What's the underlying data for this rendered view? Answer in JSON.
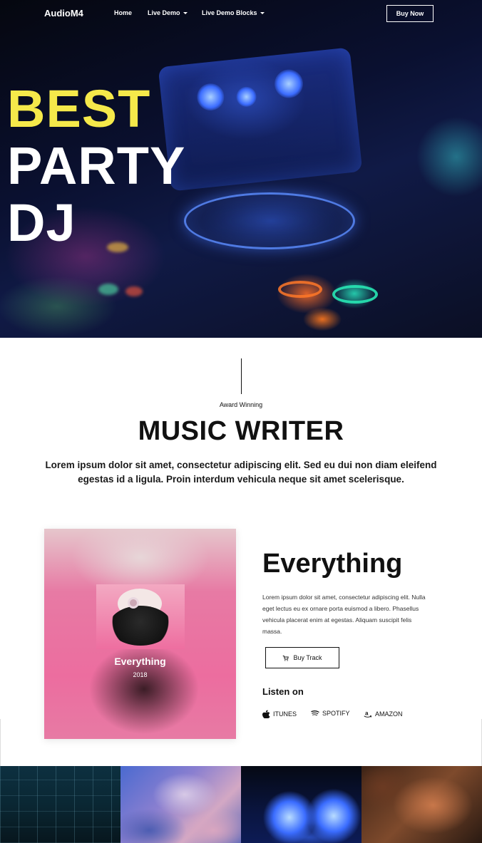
{
  "nav": {
    "brand": "AudioM4",
    "links": [
      {
        "label": "Home"
      },
      {
        "label": "Live Demo"
      },
      {
        "label": "Live Demo Blocks"
      }
    ],
    "cta": "Buy Now"
  },
  "hero": {
    "line1": "BEST",
    "line2": "PARTY",
    "line3": "DJ",
    "accent_color": "#f5e94a"
  },
  "intro": {
    "kicker": "Award Winning",
    "title": "MUSIC WRITER",
    "lead": "Lorem ipsum dolor sit amet, consectetur adipiscing elit. Sed eu dui non diam eleifend egestas id a ligula. Proin interdum vehicula neque sit amet scelerisque."
  },
  "album": {
    "cover_title": "Everything",
    "cover_year": "2018",
    "title": "Everything",
    "description": "Lorem ipsum dolor sit amet, consectetur adipiscing elit. Nulla eget lectus eu ex ornare porta euismod a libero. Phasellus vehicula placerat enim at egestas. Aliquam suscipit felis massa.",
    "buy_label": "Buy Track",
    "listen_label": "Listen on",
    "services": [
      {
        "label": "ITUNES",
        "icon": "apple-icon"
      },
      {
        "label": "SPOTIFY",
        "icon": "spotify-icon"
      },
      {
        "label": "AMAZON",
        "icon": "amazon-icon"
      }
    ]
  },
  "gallery": {
    "tiles": [
      "stage-lights-image",
      "abstract-paint-image",
      "dj-deck-image",
      "smoke-image"
    ]
  }
}
